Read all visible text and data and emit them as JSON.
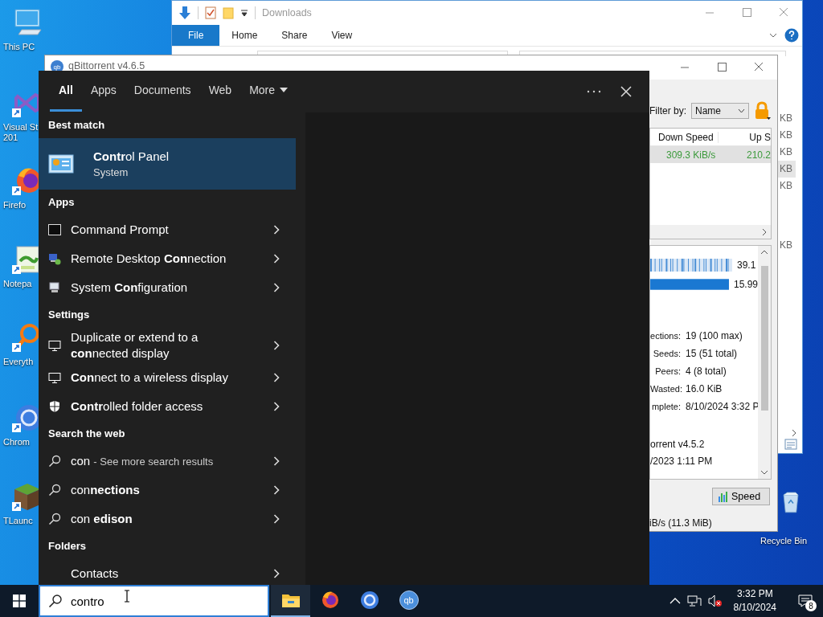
{
  "desktop_icons": [
    {
      "kind": "computer",
      "lines": [
        "This PC"
      ],
      "shortcut": false
    },
    {
      "kind": "studio",
      "lines": [
        "Visual St",
        "201"
      ],
      "shortcut": true
    },
    {
      "kind": "firefox",
      "lines": [
        "Firefo"
      ],
      "shortcut": true
    },
    {
      "kind": "notepad",
      "lines": [
        "Notepa"
      ],
      "shortcut": true
    },
    {
      "kind": "everything",
      "lines": [
        "Everyth"
      ],
      "shortcut": true
    },
    {
      "kind": "chrome",
      "lines": [
        "Chrom"
      ],
      "shortcut": true
    },
    {
      "kind": "block",
      "lines": [
        "TLaunc"
      ],
      "shortcut": true
    },
    {
      "kind": "recycle",
      "lines": [
        "Recycle Bin"
      ],
      "shortcut": false
    }
  ],
  "explorer": {
    "title": "Downloads",
    "ribbon_tabs": [
      {
        "label": "File",
        "selected": true
      },
      {
        "label": "Home",
        "selected": false
      },
      {
        "label": "Share",
        "selected": false
      },
      {
        "label": "View",
        "selected": false
      }
    ],
    "size_cells": [
      {
        "text": "KB",
        "selected": false
      },
      {
        "text": "KB",
        "selected": false
      },
      {
        "text": "KB",
        "selected": false
      },
      {
        "text": "KB",
        "selected": true
      },
      {
        "text": "KB",
        "selected": false
      },
      {
        "text": "KB",
        "selected": false
      }
    ]
  },
  "qbittorrent": {
    "logo_text": "qb",
    "title": "qBittorrent v4.6.5",
    "filter_label": "Filter by:",
    "filter_value": "Name",
    "columns": [
      "Down Speed",
      "Up S"
    ],
    "rows": [
      {
        "cells": [
          "309.3 KiB/s",
          "210.2"
        ],
        "selected": true
      }
    ],
    "bars": [
      {
        "kind": "pieces",
        "reading": "39.1"
      },
      {
        "kind": "availability",
        "reading": "15.99"
      }
    ],
    "info": [
      {
        "label": "ections:",
        "value": "19 (100 max)"
      },
      {
        "label": "Seeds:",
        "value": "15 (51 total)"
      },
      {
        "label": "Peers:",
        "value": "4 (8 total)"
      },
      {
        "label": "Wasted:",
        "value": "16.0 KiB"
      },
      {
        "label": "mplete:",
        "value": "8/10/2024 3:32 P"
      }
    ],
    "info_more": [
      "orrent v4.5.2",
      "/2023 1:11 PM"
    ],
    "speed_button": "Speed",
    "status": "iB/s (11.3 MiB)"
  },
  "search": {
    "tabs": [
      {
        "label": "All",
        "selected": true
      },
      {
        "label": "Apps",
        "selected": false
      },
      {
        "label": "Documents",
        "selected": false
      },
      {
        "label": "Web",
        "selected": false
      },
      {
        "label": "More",
        "selected": false
      }
    ],
    "sections": [
      {
        "title": "Best match",
        "items": [
          {
            "kind": "best",
            "title": "**Contr**ol Panel",
            "subtitle": "System",
            "selected": true
          }
        ]
      },
      {
        "title": "Apps",
        "items": [
          {
            "kind": "console",
            "title": "Command Prompt",
            "selected": false
          },
          {
            "kind": "remote",
            "title": "Remote Desktop **Con**nection",
            "selected": false
          },
          {
            "kind": "config",
            "title": "System **Con**figuration",
            "selected": false
          }
        ]
      },
      {
        "title": "Settings",
        "items": [
          {
            "kind": "monitor",
            "title": "Duplicate or extend to a **con**nected display",
            "selected": false
          },
          {
            "kind": "monitor",
            "title": "**Con**nect to a wireless display",
            "selected": false
          },
          {
            "kind": "shield",
            "title": "**Contr**olled folder access",
            "selected": false
          }
        ]
      },
      {
        "title": "Search the web",
        "items": [
          {
            "kind": "web",
            "title": "con",
            "hint": "- See more search results",
            "selected": false
          },
          {
            "kind": "web",
            "title": "con**nections**",
            "selected": false
          },
          {
            "kind": "web",
            "title": "con **edison**",
            "selected": false
          }
        ]
      },
      {
        "title": "Folders",
        "items": [
          {
            "kind": "folder",
            "title": "Contacts",
            "selected": false
          }
        ]
      }
    ]
  },
  "taskbar": {
    "query": "contro",
    "apps": [
      {
        "kind": "folder",
        "running": true
      },
      {
        "kind": "firefox",
        "running": false
      },
      {
        "kind": "chrome",
        "running": false
      },
      {
        "kind": "qb",
        "running": false
      }
    ],
    "qb_logo_text": "qb",
    "time": "3:32 PM",
    "date": "8/10/2024",
    "notifications": "8"
  }
}
